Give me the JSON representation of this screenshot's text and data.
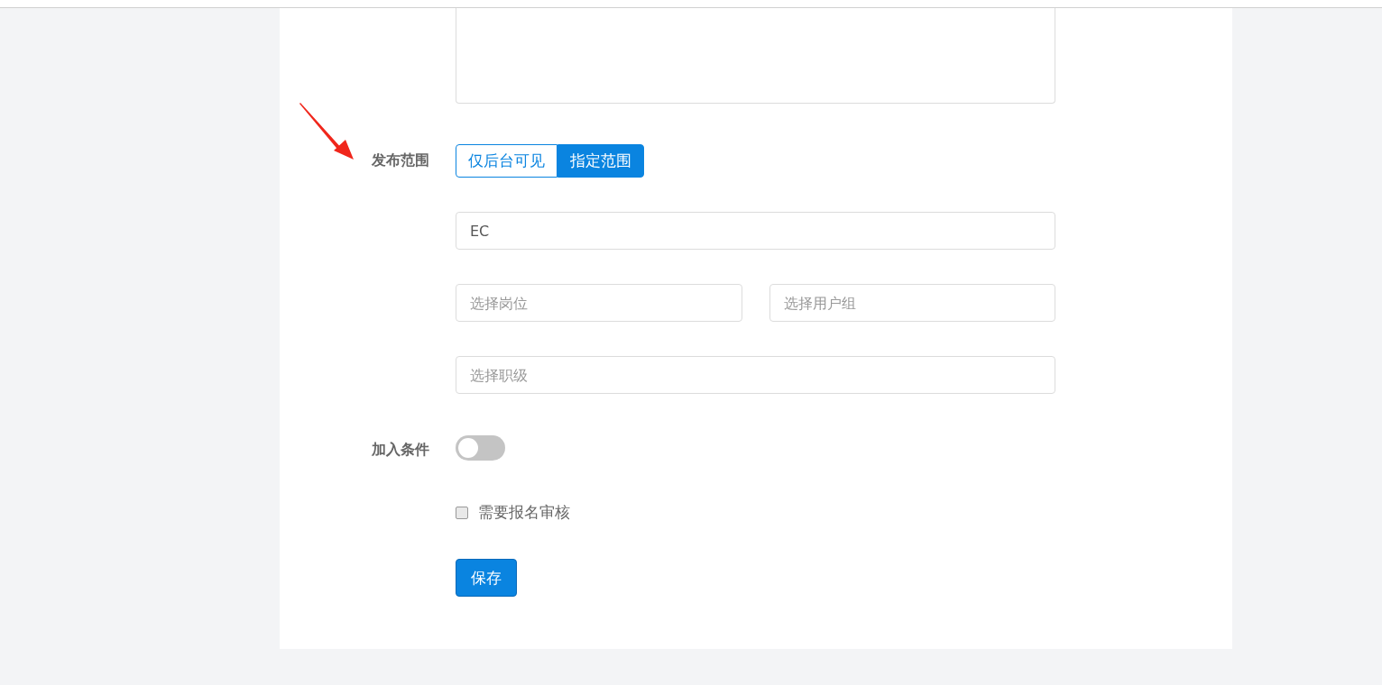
{
  "publish_scope": {
    "label": "发布范围",
    "options": [
      {
        "label": "仅后台可见",
        "selected": false
      },
      {
        "label": "指定范围",
        "selected": true
      }
    ]
  },
  "department_field": {
    "value": "EC"
  },
  "position_field": {
    "placeholder": "选择岗位"
  },
  "user_group_field": {
    "placeholder": "选择用户组"
  },
  "rank_field": {
    "placeholder": "选择职级"
  },
  "join_condition": {
    "label": "加入条件",
    "on": false
  },
  "review_checkbox": {
    "label": "需要报名审核",
    "checked": false
  },
  "save_button": {
    "label": "保存"
  }
}
